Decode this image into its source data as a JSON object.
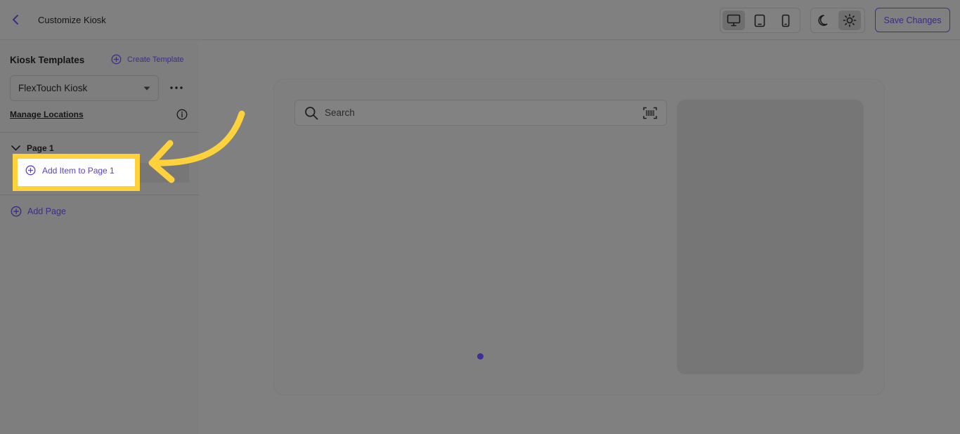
{
  "header": {
    "title": "Customize Kiosk",
    "save_label": "Save Changes",
    "devices": [
      "desktop-icon",
      "tablet-icon",
      "phone-icon"
    ],
    "active_device": "desktop",
    "themes": [
      "moon-icon",
      "sun-icon"
    ],
    "active_theme": "light"
  },
  "sidebar": {
    "heading": "Kiosk Templates",
    "create_template": "Create Template",
    "selected_template": "FlexTouch Kiosk",
    "manage_locations": "Manage Locations",
    "page": {
      "label": "Page 1",
      "add_item": "Add Item to Page 1"
    },
    "add_page": "Add Page"
  },
  "preview": {
    "search_placeholder": "Search",
    "pager_dots": 1
  },
  "colors": {
    "accent": "#3b2e86",
    "highlight": "#ffd13b",
    "overlay": "#808080"
  }
}
